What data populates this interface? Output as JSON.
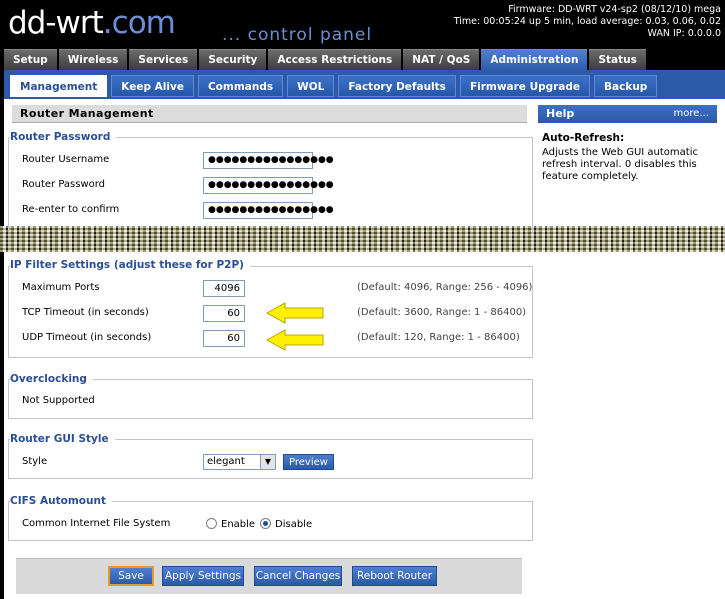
{
  "header": {
    "logo": "dd-wrt",
    "logo_dot": ".",
    "logo_suffix": "com",
    "subtitle": "... control panel",
    "firmware": "Firmware: DD-WRT v24-sp2 (08/12/10) mega",
    "time": "Time: 00:05:24 up 5 min, load average: 0.03, 0.06, 0.02",
    "wan_ip": "WAN IP: 0.0.0.0"
  },
  "main_tabs": [
    "Setup",
    "Wireless",
    "Services",
    "Security",
    "Access Restrictions",
    "NAT / QoS",
    "Administration",
    "Status"
  ],
  "sub_tabs": [
    "Management",
    "Keep Alive",
    "Commands",
    "WOL",
    "Factory Defaults",
    "Firmware Upgrade",
    "Backup"
  ],
  "page_title": "Router Management",
  "router_password": {
    "legend": "Router Password",
    "username_label": "Router Username",
    "password_label": "Router Password",
    "confirm_label": "Re-enter to confirm",
    "username_value": "●●●●●●●●●●●●●●●●",
    "password_value": "●●●●●●●●●●●●●●●●",
    "confirm_value": "●●●●●●●●●●●●●●●●"
  },
  "help": {
    "header": "Help",
    "more": "more...",
    "title": "Auto-Refresh:",
    "text": "Adjusts the Web GUI automatic refresh interval. 0 disables this feature completely."
  },
  "ip_filter": {
    "legend": "IP Filter Settings (adjust these for P2P)",
    "max_ports_label": "Maximum Ports",
    "max_ports_value": "4096",
    "max_ports_hint": "(Default: 4096, Range: 256 - 4096)",
    "tcp_label": "TCP Timeout (in seconds)",
    "tcp_value": "60",
    "tcp_hint": "(Default: 3600, Range: 1 - 86400)",
    "udp_label": "UDP Timeout (in seconds)",
    "udp_value": "60",
    "udp_hint": "(Default: 120, Range: 1 - 86400)"
  },
  "overclocking": {
    "legend": "Overclocking",
    "text": "Not Supported"
  },
  "gui_style": {
    "legend": "Router GUI Style",
    "label": "Style",
    "selected": "elegant",
    "preview": "Preview"
  },
  "cifs": {
    "legend": "CIFS Automount",
    "label": "Common Internet File System",
    "enable": "Enable",
    "disable": "Disable"
  },
  "buttons": {
    "save": "Save",
    "apply": "Apply Settings",
    "cancel": "Cancel Changes",
    "reboot": "Reboot Router"
  },
  "colors": {
    "accent_blue": "#2c5aa8",
    "arrow_yellow": "#ffef00",
    "legend_blue": "#2a4f96"
  }
}
